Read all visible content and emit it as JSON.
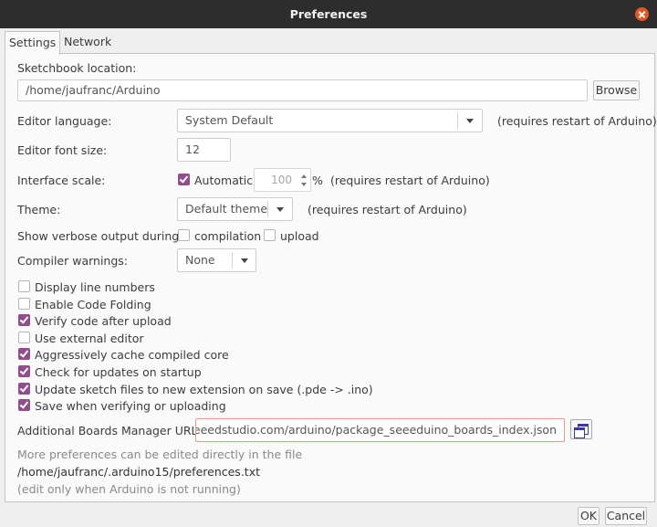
{
  "window": {
    "title": "Preferences"
  },
  "tabs": [
    {
      "label": "Settings",
      "active": true
    },
    {
      "label": "Network",
      "active": false
    }
  ],
  "sketchbook": {
    "label": "Sketchbook location:",
    "value": "/home/jaufranc/Arduino",
    "browse_label": "Browse"
  },
  "editor_language": {
    "label": "Editor language:",
    "value": "System Default",
    "note": "(requires restart of Arduino)"
  },
  "editor_font_size": {
    "label": "Editor font size:",
    "value": "12"
  },
  "interface_scale": {
    "label": "Interface scale:",
    "automatic_label": "Automatic",
    "automatic_checked": true,
    "value": "100",
    "unit": "%",
    "note": "(requires restart of Arduino)"
  },
  "theme": {
    "label": "Theme:",
    "value": "Default theme",
    "note": "(requires restart of Arduino)"
  },
  "verbose": {
    "label": "Show verbose output during:",
    "compilation_label": "compilation",
    "upload_label": "upload",
    "compilation_checked": false,
    "upload_checked": false
  },
  "compiler_warnings": {
    "label": "Compiler warnings:",
    "value": "None"
  },
  "options": [
    {
      "label": "Display line numbers",
      "checked": false
    },
    {
      "label": "Enable Code Folding",
      "checked": false
    },
    {
      "label": "Verify code after upload",
      "checked": true
    },
    {
      "label": "Use external editor",
      "checked": false
    },
    {
      "label": "Aggressively cache compiled core",
      "checked": true
    },
    {
      "label": "Check for updates on startup",
      "checked": true
    },
    {
      "label": "Update sketch files to new extension on save (.pde -> .ino)",
      "checked": true
    },
    {
      "label": "Save when verifying or uploading",
      "checked": true
    }
  ],
  "boards_urls": {
    "label": "Additional Boards Manager URLs:",
    "value": "es.seeedstudio.com/arduino/package_seeeduino_boards_index.json"
  },
  "footer": {
    "more_text": "More preferences can be edited directly in the file",
    "path": "/home/jaufranc/.arduino15/preferences.txt",
    "edit_note": "(edit only when Arduino is not running)"
  },
  "buttons": {
    "ok": "OK",
    "cancel": "Cancel"
  },
  "colors": {
    "accent": "#924d8b",
    "close": "#e95420",
    "titlebar": "#2d2d2d"
  }
}
